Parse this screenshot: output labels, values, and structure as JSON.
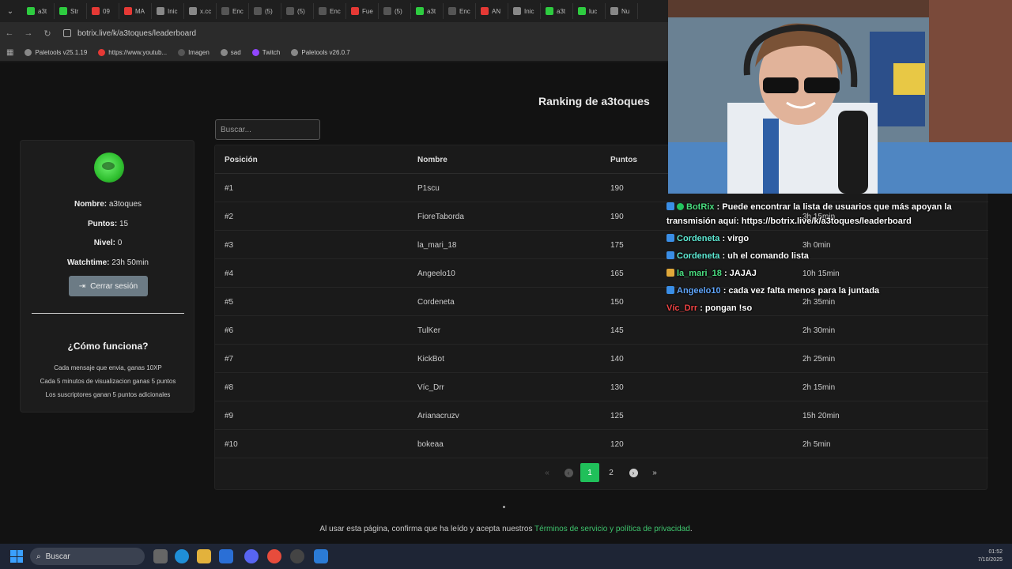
{
  "browser": {
    "tabs": [
      "a3t",
      "Str",
      "09",
      "MA",
      "Inic",
      "x.cc",
      "Enc",
      "(5)",
      "(5)",
      "Enc",
      "Fue",
      "(5)",
      "a3t",
      "Enc",
      "AN",
      "Inic",
      "a3t",
      "luc",
      "Nu"
    ],
    "url": "botrix.live/k/a3toques/leaderboard",
    "bookmarks": [
      "Paletools v25.1.19",
      "https://www.youtub...",
      "Imagen",
      "sad",
      "Twitch",
      "Paletools v26.0.7"
    ]
  },
  "page": {
    "title": "Ranking de a3toques",
    "search_placeholder": "Buscar...",
    "profile": {
      "name_label": "Nombre:",
      "name": "a3toques",
      "points_label": "Puntos:",
      "points": "15",
      "level_label": "Nivel:",
      "level": "0",
      "watch_label": "Watchtime:",
      "watch": "23h 50min",
      "logout": "Cerrar sesión"
    },
    "how": {
      "title": "¿Cómo funciona?",
      "lines": [
        "Cada mensaje que envia, ganas 10XP",
        "Cada 5 minutos de visualizacion ganas 5 puntos",
        "Los suscriptores ganan 5 puntos adicionales"
      ]
    },
    "table": {
      "headers": [
        "Posición",
        "Nombre",
        "Puntos"
      ],
      "rows": [
        {
          "pos": "#1",
          "name": "P1scu",
          "points": "190",
          "time": ""
        },
        {
          "pos": "#2",
          "name": "FioreTaborda",
          "points": "190",
          "time": "3h 15min"
        },
        {
          "pos": "#3",
          "name": "la_mari_18",
          "points": "175",
          "time": "3h 0min"
        },
        {
          "pos": "#4",
          "name": "Angeelo10",
          "points": "165",
          "time": "10h 15min"
        },
        {
          "pos": "#5",
          "name": "Cordeneta",
          "points": "150",
          "time": "2h 35min"
        },
        {
          "pos": "#6",
          "name": "TulKer",
          "points": "145",
          "time": "2h 30min"
        },
        {
          "pos": "#7",
          "name": "KickBot",
          "points": "140",
          "time": "2h 25min"
        },
        {
          "pos": "#8",
          "name": "Víc_Drr",
          "points": "130",
          "time": "2h 15min"
        },
        {
          "pos": "#9",
          "name": "Arianacruzv",
          "points": "125",
          "time": "15h 20min"
        },
        {
          "pos": "#10",
          "name": "bokeaa",
          "points": "120",
          "time": "2h 5min"
        }
      ]
    },
    "pager": {
      "first": "«",
      "prev": "‹",
      "pages": [
        "1",
        "2"
      ],
      "active": "1",
      "next": "›",
      "last": "»"
    },
    "footer": {
      "text": "Al usar esta página, confirma que ha leído y acepta nuestros ",
      "link": "Términos de servicio y política de privacidad",
      "end": "."
    }
  },
  "chat": [
    {
      "user": "BotRix",
      "color": "#4ade80",
      "text": " : Puede encontrar la lista de usuarios que más apoyan la transmisión aquí: https://botrix.live/k/a3toques/leaderboard",
      "badge": "blue",
      "check": true
    },
    {
      "user": "Cordeneta",
      "color": "#5eead4",
      "text": " : virgo",
      "badge": "blue"
    },
    {
      "user": "Cordeneta",
      "color": "#5eead4",
      "text": " : uh el comando lista",
      "badge": "blue"
    },
    {
      "user": "la_mari_18",
      "color": "#4ade80",
      "text": " : JAJAJ",
      "badge": "gold"
    },
    {
      "user": "Angeelo10",
      "color": "#60a5fa",
      "text": " : cada vez falta menos para la juntada",
      "badge": "blue"
    },
    {
      "user": "Víc_Drr",
      "color": "#ef4444",
      "text": " : pongan !so",
      "badge": ""
    }
  ],
  "taskbar": {
    "search": "Buscar",
    "time": "01:52",
    "date": "7/10/2025"
  }
}
